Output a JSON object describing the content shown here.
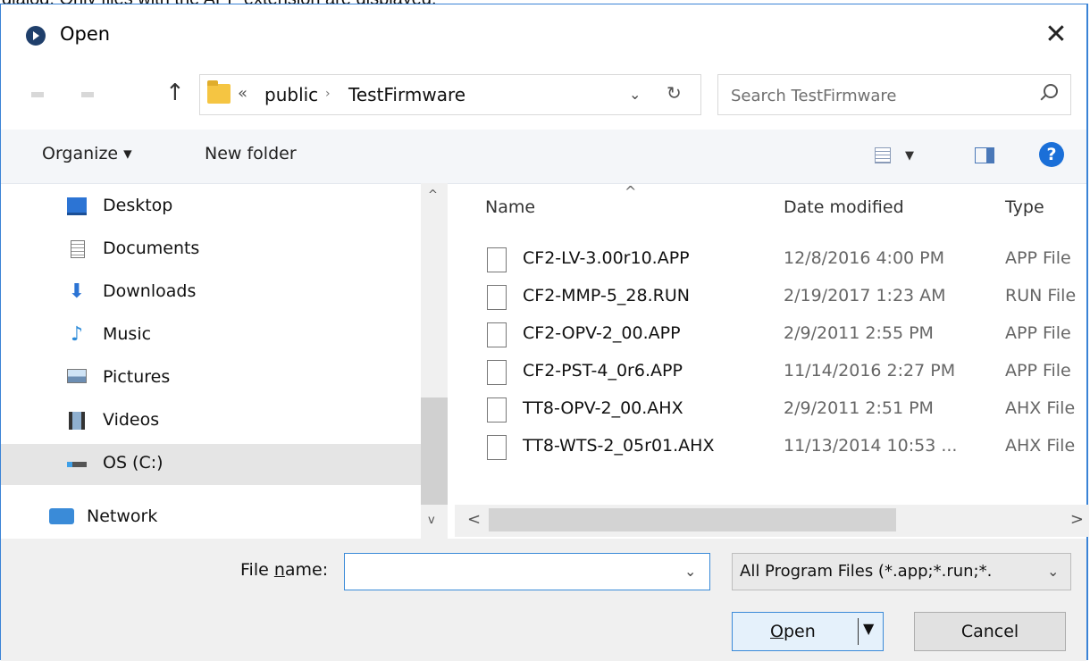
{
  "top_text": "dialog. Only files with the APP extension are displayed.",
  "window": {
    "title": "Open",
    "close_glyph": "✕"
  },
  "address": {
    "up_glyph": "↑",
    "overflow": "«",
    "crumbs": [
      "public",
      "TestFirmware"
    ],
    "crumb_separator": "›",
    "dropdown_glyph": "⌄",
    "refresh_glyph": "↻"
  },
  "search": {
    "placeholder": "Search TestFirmware"
  },
  "toolbar": {
    "organize": "Organize ▾",
    "new_folder": "New folder",
    "view_dropdown": "▼",
    "help": "?"
  },
  "nav": {
    "items": [
      {
        "label": "Desktop",
        "icon": "desktop-icon"
      },
      {
        "label": "Documents",
        "icon": "documents-icon"
      },
      {
        "label": "Downloads",
        "icon": "downloads-icon"
      },
      {
        "label": "Music",
        "icon": "music-icon"
      },
      {
        "label": "Pictures",
        "icon": "pictures-icon"
      },
      {
        "label": "Videos",
        "icon": "videos-icon"
      },
      {
        "label": "OS (C:)",
        "icon": "drive-icon",
        "selected": true
      },
      {
        "label": "Network",
        "icon": "network-icon"
      }
    ],
    "scroll_up": "^",
    "scroll_down": "v"
  },
  "files": {
    "sort_caret": "^",
    "columns": {
      "name": "Name",
      "date": "Date modified",
      "type": "Type"
    },
    "rows": [
      {
        "name": "CF2-LV-3.00r10.APP",
        "date": "12/8/2016 4:00 PM",
        "type": "APP File"
      },
      {
        "name": "CF2-MMP-5_28.RUN",
        "date": "2/19/2017 1:23 AM",
        "type": "RUN File"
      },
      {
        "name": "CF2-OPV-2_00.APP",
        "date": "2/9/2011 2:55 PM",
        "type": "APP File"
      },
      {
        "name": "CF2-PST-4_0r6.APP",
        "date": "11/14/2016 2:27 PM",
        "type": "APP File"
      },
      {
        "name": "TT8-OPV-2_00.AHX",
        "date": "2/9/2011 2:51 PM",
        "type": "AHX File"
      },
      {
        "name": "TT8-WTS-2_05r01.AHX",
        "date": "11/13/2014 10:53 ...",
        "type": "AHX File"
      }
    ],
    "scroll_left": "<",
    "scroll_right": ">"
  },
  "footer": {
    "file_name_label_pre": "File ",
    "file_name_label_u": "n",
    "file_name_label_post": "ame:",
    "file_name_value": "",
    "filter": "All Program Files (*.app;*.run;*.",
    "open_u": "O",
    "open_rest": "pen",
    "cancel": "Cancel"
  },
  "colors": {
    "accent": "#3a83d6",
    "toolbar_bg": "#f4f6f9",
    "footer_bg": "#f0f0f0",
    "help": "#1a6fd8"
  }
}
